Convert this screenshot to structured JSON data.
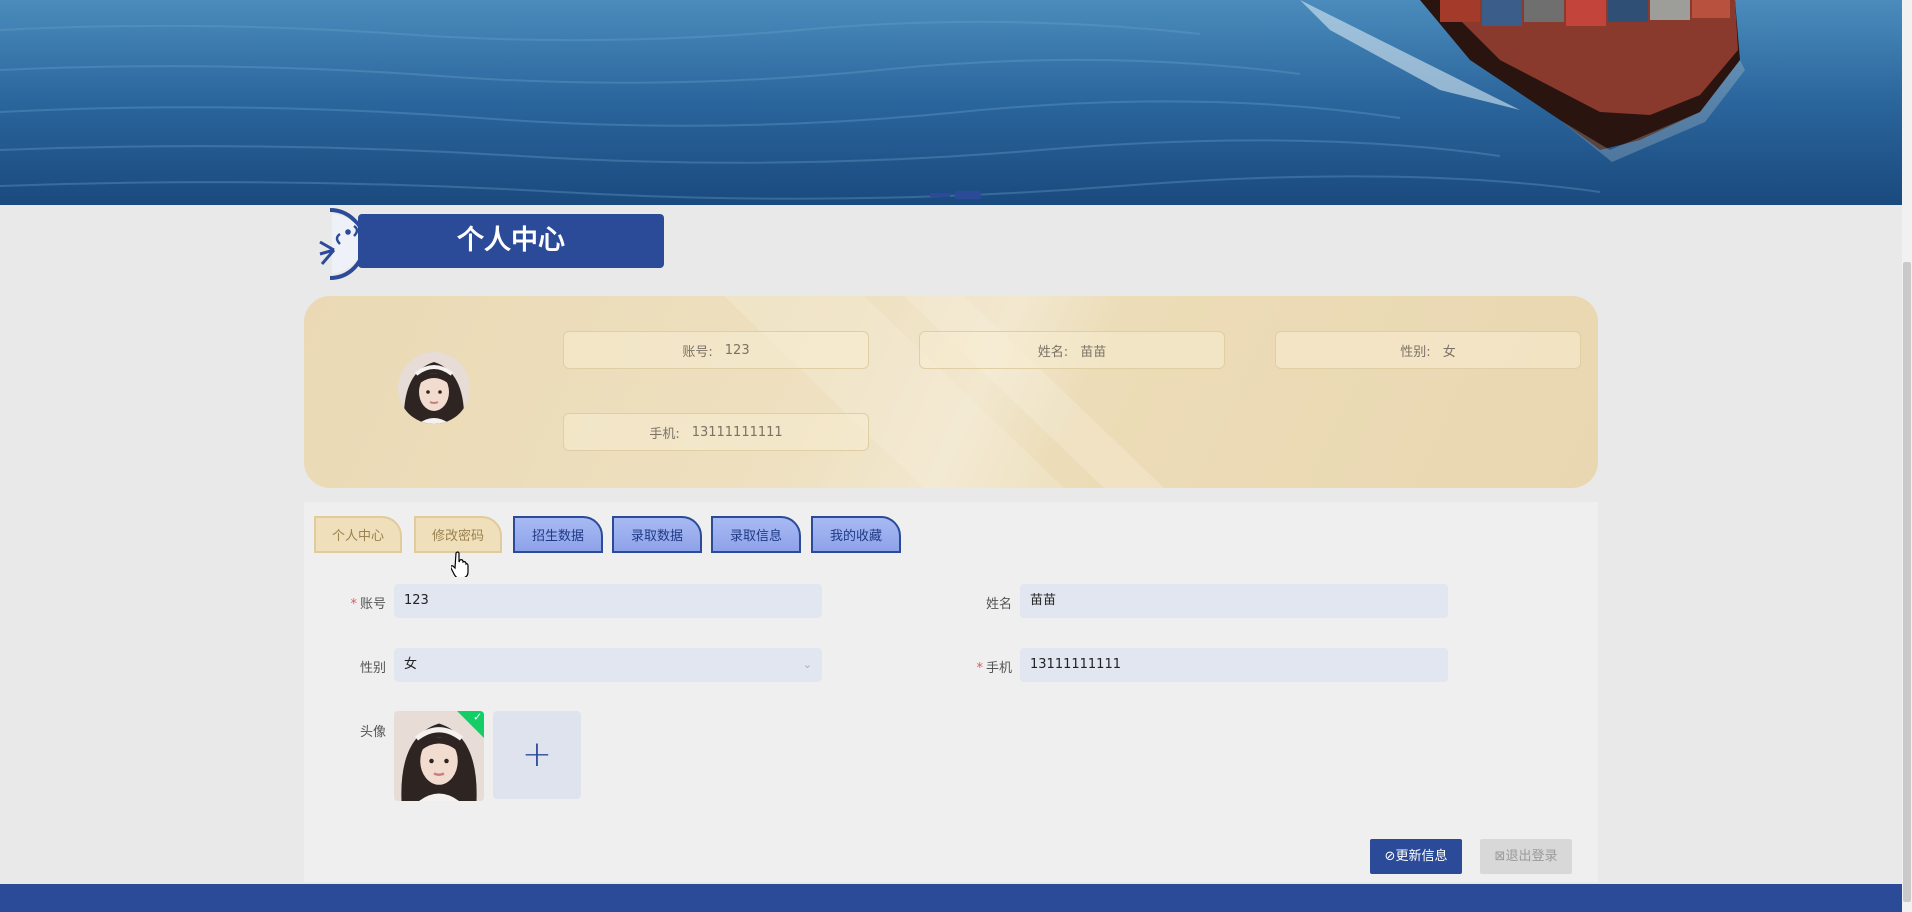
{
  "page": {
    "section_title": "个人中心",
    "title_icon": "speaking-face-icon"
  },
  "profile": {
    "fields": [
      {
        "label": "账号:",
        "value": "123"
      },
      {
        "label": "姓名:",
        "value": "苗苗"
      },
      {
        "label": "性别:",
        "value": "女"
      },
      {
        "label": "手机:",
        "value": "13111111111"
      }
    ]
  },
  "tabs": [
    {
      "label": "个人中心",
      "style": "gold"
    },
    {
      "label": "修改密码",
      "style": "gold"
    },
    {
      "label": "招生数据",
      "style": "blue"
    },
    {
      "label": "录取数据",
      "style": "blue"
    },
    {
      "label": "录取信息",
      "style": "blue"
    },
    {
      "label": "我的收藏",
      "style": "blue"
    }
  ],
  "form": {
    "account": {
      "label": "账号",
      "value": "123",
      "required": true
    },
    "name": {
      "label": "姓名",
      "value": "苗苗",
      "required": false
    },
    "gender": {
      "label": "性别",
      "value": "女",
      "required": false
    },
    "phone": {
      "label": "手机",
      "value": "13111111111",
      "required": true
    },
    "avatar": {
      "label": "头像",
      "add_symbol": "+"
    },
    "required_mark": "*",
    "select_chevron": "⌄"
  },
  "buttons": {
    "update": {
      "icon": "⊘",
      "label": "更新信息"
    },
    "logout": {
      "icon": "⊠",
      "label": "退出登录"
    }
  },
  "colors": {
    "primary": "#2b4b98",
    "gold_card": "#ead9b4",
    "success": "#13ce66"
  }
}
